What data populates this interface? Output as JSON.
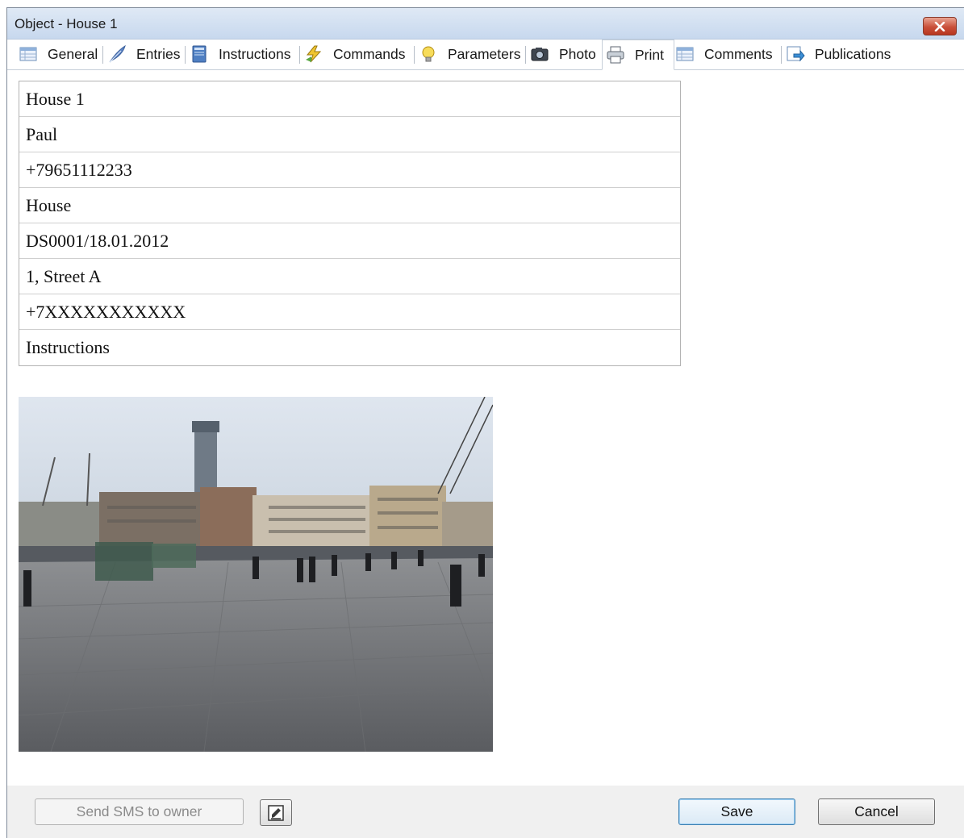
{
  "window": {
    "title": "Object - House 1"
  },
  "tabs": [
    {
      "label": "General",
      "icon": "table-icon"
    },
    {
      "label": "Entries",
      "icon": "feather-icon"
    },
    {
      "label": "Instructions",
      "icon": "book-icon"
    },
    {
      "label": "Commands",
      "icon": "lightning-icon"
    },
    {
      "label": "Parameters",
      "icon": "lightbulb-icon"
    },
    {
      "label": "Photo",
      "icon": "camera-icon"
    },
    {
      "label": "Print",
      "icon": "printer-icon"
    },
    {
      "label": "Comments",
      "icon": "table-icon"
    },
    {
      "label": "Publications",
      "icon": "export-icon"
    }
  ],
  "active_tab": "Print",
  "print_fields": [
    "House 1",
    "Paul",
    "+79651112233",
    "House",
    "DS0001/18.01.2012",
    "1, Street A",
    "+7XXXXXXXXXXX",
    "Instructions"
  ],
  "footer": {
    "send_sms_label": "Send SMS to owner",
    "save_label": "Save",
    "cancel_label": "Cancel"
  },
  "colors": {
    "titlebar": "#c7d8ee",
    "close_button": "#c9503a",
    "default_button_border": "#3c7fb1"
  }
}
